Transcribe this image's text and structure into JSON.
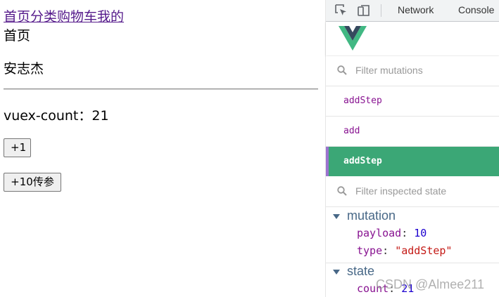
{
  "page": {
    "nav": [
      "首页",
      "分类",
      "购物车",
      "我的"
    ],
    "route_text": "首页",
    "user_text": "安志杰",
    "count_label": "vuex-count：",
    "count_value": "21",
    "btn_add1": "+1",
    "btn_add10": "+10传参"
  },
  "devtools": {
    "tabs": [
      "Network",
      "Console"
    ],
    "filter_mutations_placeholder": "Filter mutations",
    "mutations": [
      {
        "name": "addStep",
        "active": false
      },
      {
        "name": "add",
        "active": false
      },
      {
        "name": "addStep",
        "active": true
      }
    ],
    "filter_state_placeholder": "Filter inspected state",
    "mutation_section": {
      "title": "mutation",
      "payload_key": "payload",
      "payload_value": "10",
      "type_key": "type",
      "type_value": "\"addStep\""
    },
    "state_section": {
      "title": "state",
      "count_key": "count",
      "count_value": "21"
    },
    "colors": {
      "active_bg": "#3ba776",
      "active_border": "#9b72cf",
      "key": "#881391",
      "number": "#1c00cf",
      "string": "#c41a16",
      "section_title": "#486887"
    },
    "icons": [
      "inspect-element-icon",
      "device-toolbar-icon",
      "vue-logo",
      "search-icon"
    ]
  },
  "watermark": "CSDN @Almee211"
}
